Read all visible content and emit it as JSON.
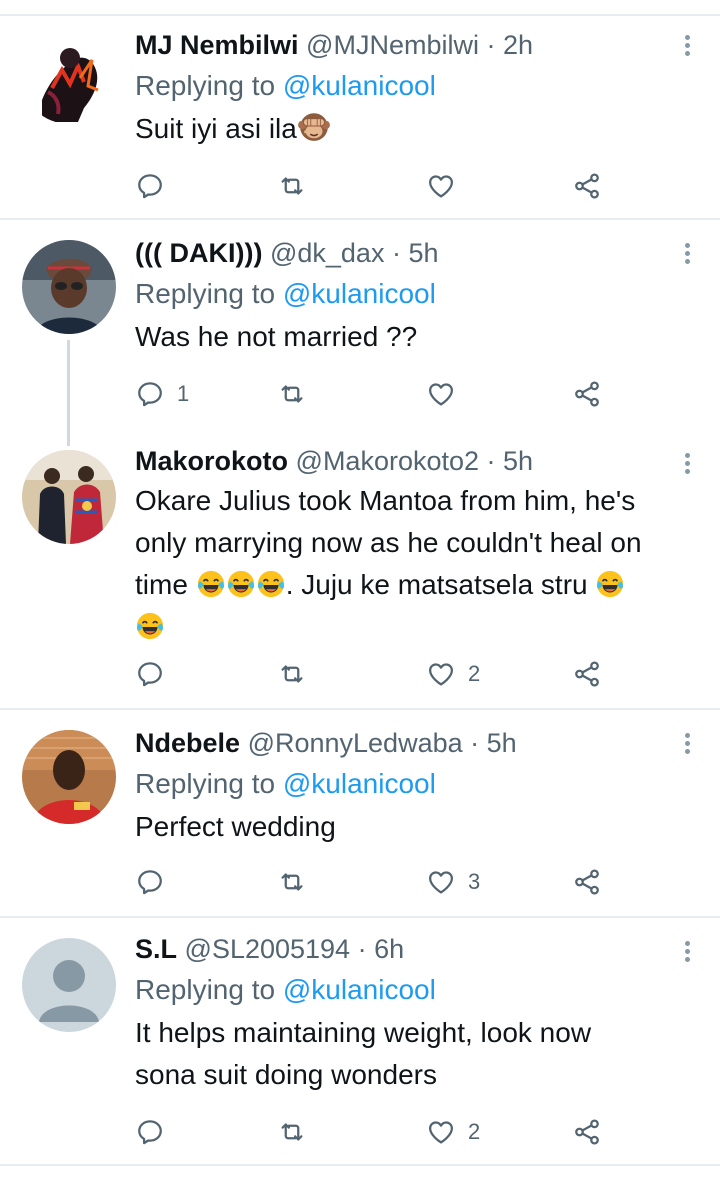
{
  "tweets": [
    {
      "name": "MJ Nembilwi",
      "handle": "@MJNembilwi",
      "time": "· 2h",
      "replying_prefix": "Replying to ",
      "replying_to": "@kulanicool",
      "text": "Suit iyi asi ila",
      "emoji": "see-no-evil-monkey",
      "counts": {
        "reply": "",
        "retweet": "",
        "like": ""
      }
    },
    {
      "name": "((( DAKI)))",
      "handle": "@dk_dax",
      "time": "· 5h",
      "replying_prefix": "Replying to ",
      "replying_to": "@kulanicool",
      "text": "Was he not married ??",
      "counts": {
        "reply": "1",
        "retweet": "",
        "like": ""
      }
    },
    {
      "name": "Makorokoto",
      "handle": "@Makorokoto2",
      "time": "· 5h",
      "text_line1": "Okare Julius took Mantoa from him, he's",
      "text_line2": "only marrying now as he couldn't heal on",
      "text_line3a": "time ",
      "text_line3b": ". Juju ke matsatsela stru ",
      "emoji": "face-with-tears-of-joy",
      "counts": {
        "reply": "",
        "retweet": "",
        "like": "2"
      }
    },
    {
      "name": "Ndebele",
      "handle": "@RonnyLedwaba",
      "time": "· 5h",
      "replying_prefix": "Replying to ",
      "replying_to": "@kulanicool",
      "text": "Perfect wedding",
      "counts": {
        "reply": "",
        "retweet": "",
        "like": "3"
      }
    },
    {
      "name": "S.L",
      "handle": "@SL2005194",
      "time": "· 6h",
      "replying_prefix": "Replying to ",
      "replying_to": "@kulanicool",
      "text_line1": "It helps maintaining weight, look now",
      "text_line2": "sona suit doing wonders",
      "counts": {
        "reply": "",
        "retweet": "",
        "like": "2"
      }
    }
  ],
  "icons": {
    "reply": "reply-icon",
    "retweet": "retweet-icon",
    "like": "heart-icon",
    "share": "share-icon",
    "more": "more-icon"
  },
  "colors": {
    "text": "#0f1419",
    "secondary": "#536471",
    "link": "#1d9bf0",
    "divider": "#e6ecf0",
    "icon": "#536471"
  }
}
